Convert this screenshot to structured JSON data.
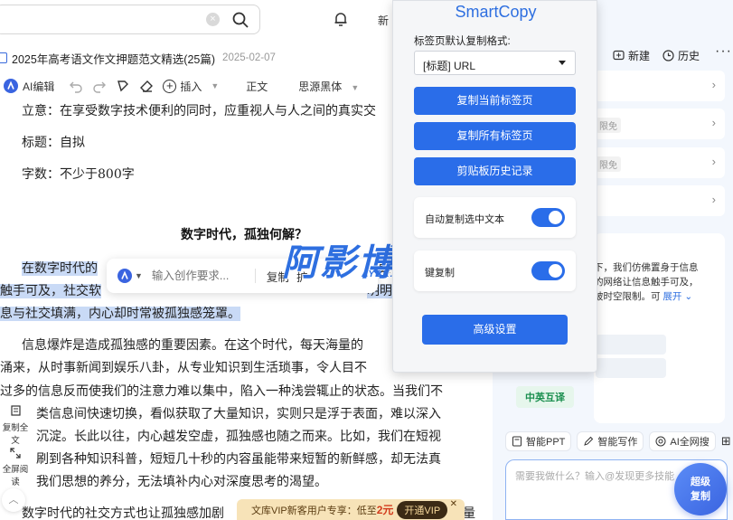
{
  "topbar": {
    "new_label": "新"
  },
  "doc": {
    "title": "2025年高考语文作文押题范文精选(25篇)",
    "date": "2025-02-07"
  },
  "toolbar": {
    "ai_edit": "AI编辑",
    "insert": "插入",
    "style": "正文",
    "font": "思源黑体"
  },
  "content": {
    "line_intent": "立意：在享受数字技术便利的同时，应重视人与人之间的真实交",
    "line_title_req": "标题：自拟",
    "line_words": "字数：不少于800字",
    "essay_title": "数字时代，孤独何解？",
    "p1_a": "在数字时代的",
    "p1_a_tail": "更",
    "p1_b": "触手可及，社交软",
    "p1_b_tail": "明明",
    "p1_c": "息与社交填满，内心却时常被孤独感笼罩。",
    "p2_1": "信息爆炸是造成孤独感的重要因素。在这个时代，每天海量的",
    "p2_2": "涌来，从时事新闻到娱乐八卦，从专业知识到生活琐事，令人目不",
    "p2_3": "过多的信息反而使我们的注意力难以集中，陷入一种浅尝辄止的状态。当我们不",
    "p2_4": "类信息间快速切换，看似获取了大量知识，实则只是浮于表面，难以深入",
    "p2_5": "沉淀。长此以往，内心越发空虚，孤独感也随之而来。比如，我们在短视",
    "p2_6": "刷到各种知识科普，短短几十秒的内容虽能带来短暂的新鲜感，却无法真",
    "p2_7": "我们思想的养分，无法填补内心对深度思考的渴望。",
    "p3_1": "数字时代的社交方式也让孤独感加剧",
    "p3_tail": "量"
  },
  "aibar": {
    "placeholder": "输入创作要求...",
    "btn_copy": "复制",
    "btn_more": "扩"
  },
  "watermark": {
    "main": "阿影博客",
    "sub": "AYBK.NET"
  },
  "left_tools": {
    "copy_all": "复制全文",
    "fullscreen": "全屏阅读"
  },
  "vip": {
    "text": "文库VIP新客用户专享：低至",
    "price": "2元",
    "button": "开通VIP"
  },
  "assistant": {
    "new_label": "新建",
    "history_label": "历史",
    "limited_tag_1": "限免",
    "limited_tag_2": "限免",
    "reply_1": "下，我们仿佛置身于信息",
    "reply_2": "的网络让信息触手可及，",
    "reply_3": "破时空限制。可",
    "expand": "展开",
    "chip_green": "中英互译",
    "tools": [
      "智能PPT",
      "智能写作",
      "AI全网搜"
    ],
    "input_placeholder": "需要我做什么？输入@发现更多技能",
    "fab": "超级复制"
  },
  "smartcopy": {
    "title": "SmartCopy",
    "format_label": "标签页默认复制格式:",
    "format_value": "[标题] URL",
    "btn_copy_current": "复制当前标签页",
    "btn_copy_all": "复制所有标签页",
    "btn_clipboard": "剪贴板历史记录",
    "auto_copy_label": "自动复制选中文本",
    "auto_copy_on": true,
    "second_toggle_label": "键复制",
    "second_toggle_on": true,
    "btn_advanced": "高级设置",
    "accent": "#2a6de9"
  }
}
